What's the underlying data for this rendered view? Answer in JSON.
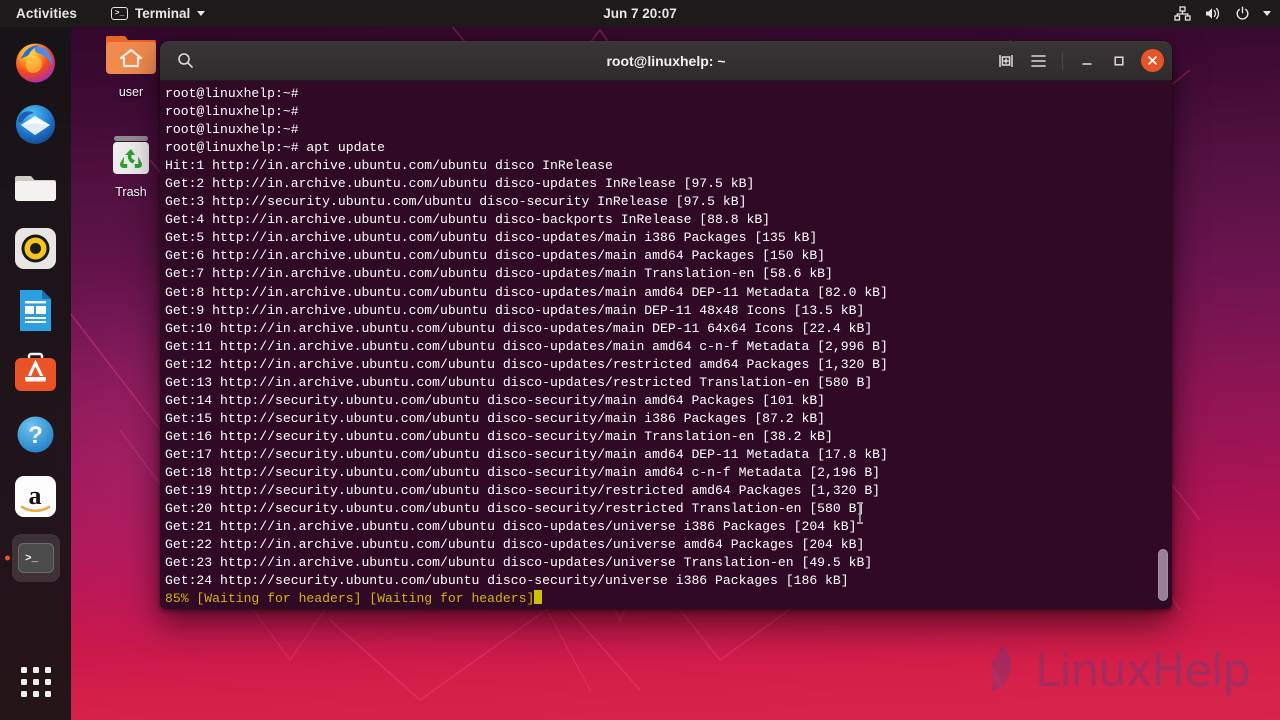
{
  "topbar": {
    "activities": "Activities",
    "app_menu": "Terminal",
    "app_glyph": ">_",
    "clock": "Jun 7  20:07",
    "tray_icons": [
      "network-icon",
      "volume-icon",
      "power-icon",
      "chevron-down-icon"
    ]
  },
  "dock": {
    "items": [
      {
        "name": "firefox",
        "label": "Firefox",
        "running": false
      },
      {
        "name": "thunderbird",
        "label": "Thunderbird Mail",
        "running": false
      },
      {
        "name": "files",
        "label": "Files",
        "running": false
      },
      {
        "name": "rhythmbox",
        "label": "Rhythmbox",
        "running": false
      },
      {
        "name": "libreoffice-writer",
        "label": "LibreOffice Writer",
        "running": false
      },
      {
        "name": "ubuntu-software",
        "label": "Ubuntu Software",
        "running": false
      },
      {
        "name": "help",
        "label": "Help",
        "running": false
      },
      {
        "name": "amazon",
        "label": "Amazon",
        "running": false
      },
      {
        "name": "terminal",
        "label": "Terminal",
        "running": true
      }
    ],
    "show_applications": "Show Applications"
  },
  "desktop": {
    "icons": [
      {
        "name": "home-folder",
        "label": "user"
      },
      {
        "name": "trash",
        "label": "Trash"
      }
    ]
  },
  "terminal": {
    "title": "root@linuxhelp: ~",
    "titlebar_buttons": {
      "search": "search-icon",
      "new_tab": "new-tab-icon",
      "menu": "hamburger-menu-icon",
      "minimize": "minimize-button",
      "maximize": "maximize-button",
      "close": "close-button"
    },
    "background_color": "#300a24",
    "text_color": "#ffffff",
    "status_color": "#d3b211",
    "lines": [
      "root@linuxhelp:~#",
      "root@linuxhelp:~#",
      "root@linuxhelp:~#",
      "root@linuxhelp:~# apt update",
      "Hit:1 http://in.archive.ubuntu.com/ubuntu disco InRelease",
      "Get:2 http://in.archive.ubuntu.com/ubuntu disco-updates InRelease [97.5 kB]",
      "Get:3 http://security.ubuntu.com/ubuntu disco-security InRelease [97.5 kB]",
      "Get:4 http://in.archive.ubuntu.com/ubuntu disco-backports InRelease [88.8 kB]",
      "Get:5 http://in.archive.ubuntu.com/ubuntu disco-updates/main i386 Packages [135 kB]",
      "Get:6 http://in.archive.ubuntu.com/ubuntu disco-updates/main amd64 Packages [150 kB]",
      "Get:7 http://in.archive.ubuntu.com/ubuntu disco-updates/main Translation-en [58.6 kB]",
      "Get:8 http://in.archive.ubuntu.com/ubuntu disco-updates/main amd64 DEP-11 Metadata [82.0 kB]",
      "Get:9 http://in.archive.ubuntu.com/ubuntu disco-updates/main DEP-11 48x48 Icons [13.5 kB]",
      "Get:10 http://in.archive.ubuntu.com/ubuntu disco-updates/main DEP-11 64x64 Icons [22.4 kB]",
      "Get:11 http://in.archive.ubuntu.com/ubuntu disco-updates/main amd64 c-n-f Metadata [2,996 B]",
      "Get:12 http://in.archive.ubuntu.com/ubuntu disco-updates/restricted amd64 Packages [1,320 B]",
      "Get:13 http://in.archive.ubuntu.com/ubuntu disco-updates/restricted Translation-en [580 B]",
      "Get:14 http://security.ubuntu.com/ubuntu disco-security/main amd64 Packages [101 kB]",
      "Get:15 http://security.ubuntu.com/ubuntu disco-security/main i386 Packages [87.2 kB]",
      "Get:16 http://security.ubuntu.com/ubuntu disco-security/main Translation-en [38.2 kB]",
      "Get:17 http://security.ubuntu.com/ubuntu disco-security/main amd64 DEP-11 Metadata [17.8 kB]",
      "Get:18 http://security.ubuntu.com/ubuntu disco-security/main amd64 c-n-f Metadata [2,196 B]",
      "Get:19 http://security.ubuntu.com/ubuntu disco-security/restricted amd64 Packages [1,320 B]",
      "Get:20 http://security.ubuntu.com/ubuntu disco-security/restricted Translation-en [580 B]",
      "Get:21 http://in.archive.ubuntu.com/ubuntu disco-updates/universe i386 Packages [204 kB]",
      "Get:22 http://in.archive.ubuntu.com/ubuntu disco-updates/universe amd64 Packages [204 kB]",
      "Get:23 http://in.archive.ubuntu.com/ubuntu disco-updates/universe Translation-en [49.5 kB]",
      "Get:24 http://security.ubuntu.com/ubuntu disco-security/universe i386 Packages [186 kB]"
    ],
    "status_line": "85% [Waiting for headers] [Waiting for headers]"
  },
  "watermark": {
    "part1": "Linux",
    "part2": "Help"
  }
}
